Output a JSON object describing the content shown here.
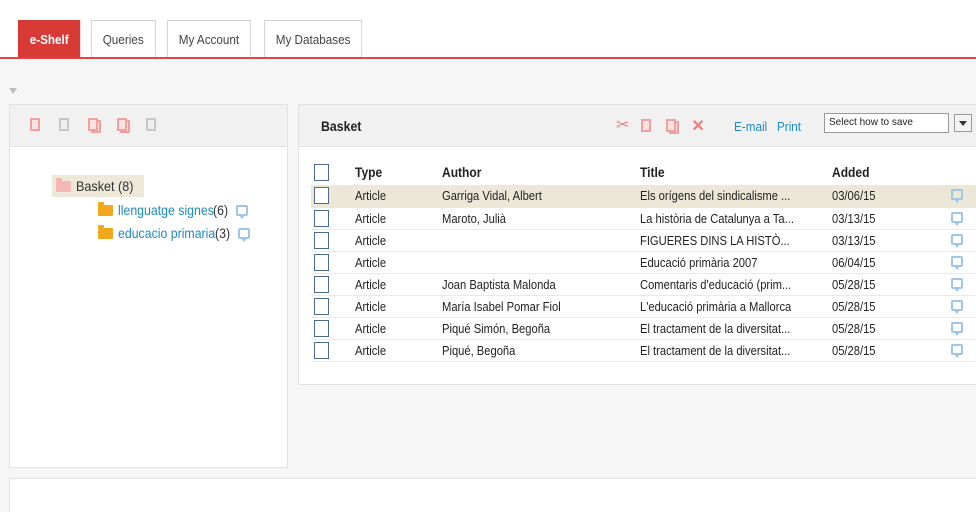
{
  "tabs": [
    {
      "label": "e-Shelf",
      "active": true
    },
    {
      "label": "Queries",
      "active": false
    },
    {
      "label": "My Account",
      "active": false
    },
    {
      "label": "My Databases",
      "active": false
    }
  ],
  "colors": {
    "accent": "#d83a36",
    "link": "#1f8bbf",
    "highlight": "#ece7d7"
  },
  "left_toolbar": {
    "icons": [
      "new-folder-icon",
      "rename-folder-icon",
      "copy-folder-icon",
      "paste-folder-icon",
      "delete-folder-icon"
    ]
  },
  "tree": {
    "root": {
      "label": "Basket (8)"
    },
    "children": [
      {
        "name": "llenguatge signes",
        "count": " (6)"
      },
      {
        "name": "educacio primaria",
        "count": " (3)"
      }
    ]
  },
  "basket": {
    "title": "Basket",
    "email_label": "E-mail",
    "print_label": "Print",
    "save_select": "Select how to save",
    "icons": [
      "cut-icon",
      "copy-icon",
      "paste-icon",
      "delete-icon"
    ]
  },
  "table": {
    "headers": {
      "type": "Type",
      "author": "Author",
      "title": "Title",
      "added": "Added"
    },
    "rows": [
      {
        "type": "Article",
        "author": "Garriga Vidal, Albert",
        "title": "Els orígens del sindicalisme ...",
        "added": "03/06/15"
      },
      {
        "type": "Article",
        "author": "Maroto, Julià",
        "title": "La història de Catalunya a Ta...",
        "added": "03/13/15"
      },
      {
        "type": "Article",
        "author": "",
        "title": "FIGUERES DINS LA HISTÒ...",
        "added": "03/13/15"
      },
      {
        "type": "Article",
        "author": "",
        "title": "Educació primària 2007",
        "added": "06/04/15"
      },
      {
        "type": "Article",
        "author": "Joan Baptista Malonda",
        "title": "Comentaris d'educació (prim...",
        "added": "05/28/15"
      },
      {
        "type": "Article",
        "author": "María Isabel Pomar Fiol",
        "title": "L'educació primària a Mallorca",
        "added": "05/28/15"
      },
      {
        "type": "Article",
        "author": "Piqué Simón, Begoña",
        "title": "El tractament de la diversitat...",
        "added": "05/28/15"
      },
      {
        "type": "Article",
        "author": "Piqué, Begoña",
        "title": "El tractament de la diversitat...",
        "added": "05/28/15"
      }
    ]
  }
}
